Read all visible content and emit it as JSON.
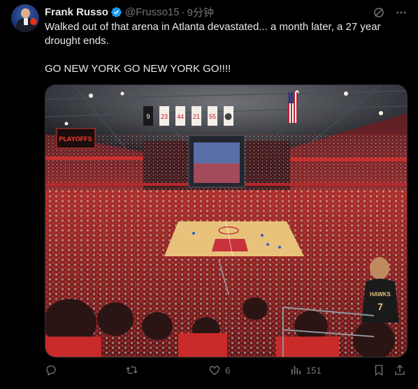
{
  "author": {
    "name": "Frank Russo",
    "handle": "@Frusso15",
    "separator": "·",
    "time": "9分钟"
  },
  "tweet": {
    "line1": "Walked out of that arena in Atlanta devastated... a month later, a 27 year drought ends.",
    "line2": "GO NEW YORK GO NEW YORK GO!!!!"
  },
  "media": {
    "banners": [
      "9",
      "23",
      "44",
      "21",
      "55",
      "⚫"
    ],
    "scoreboard_text": "PLAYOFFS",
    "jersey_text": "HAWKS",
    "jersey_number": "7"
  },
  "actions": {
    "replies": "",
    "retweets": "",
    "likes": "6",
    "views": "151"
  },
  "colors": {
    "background": "#000000",
    "text": "#e7e9ea",
    "muted": "#71767b",
    "verified": "#1d9bf0"
  }
}
